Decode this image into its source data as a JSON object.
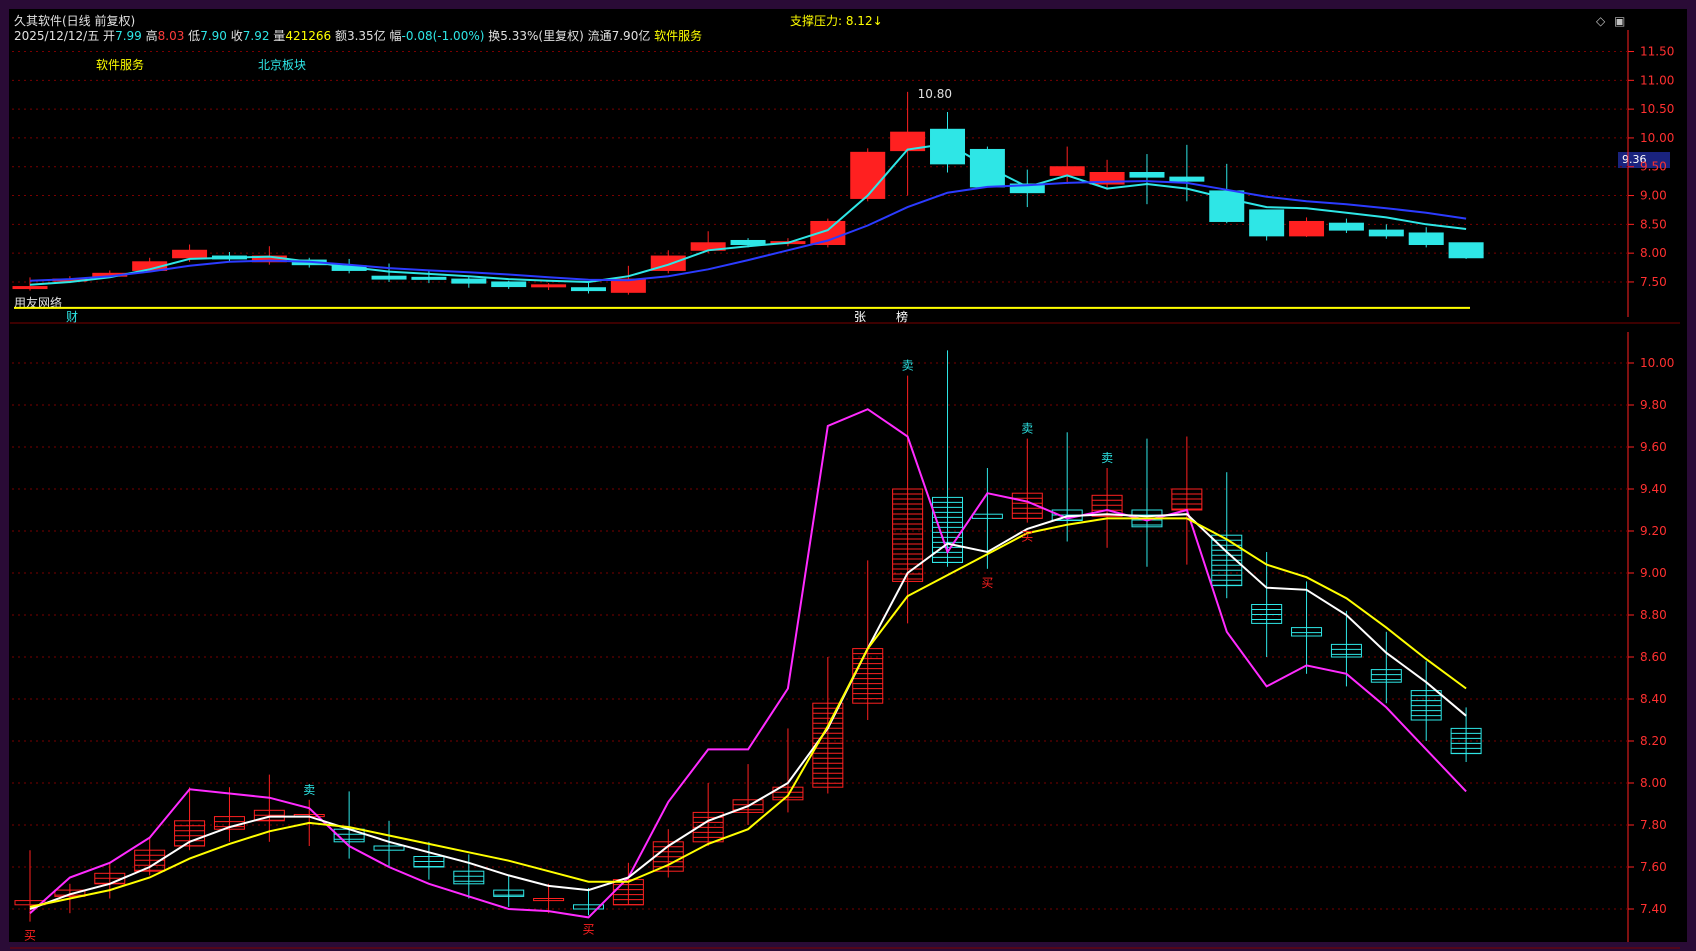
{
  "header": {
    "stock_title": "久其软件(日线 前复权)",
    "support_pressure": "支撑压力: 8.12",
    "date": "2025/12/12/五",
    "open_label": "开",
    "open": "7.99",
    "high_label": "高",
    "high": "8.03",
    "low_label": "低",
    "low": "7.90",
    "close_label": "收",
    "close": "7.92",
    "volume_label": "量",
    "volume": "421266",
    "amount_label": "额",
    "amount": "3.35亿",
    "change_label": "幅",
    "change": "-0.08(-1.00%)",
    "turnover_label": "换",
    "turnover": "5.33%(里复权)",
    "float_label": "流通",
    "float": "7.90亿",
    "sector": "软件服务"
  },
  "tags": {
    "industry": "软件服务",
    "region": "北京板块",
    "bottom_left": "用友网络",
    "cai": "财",
    "zhang": "张",
    "bang": "榜",
    "top_axis_value": "9.36",
    "high_marker": "10.80"
  },
  "icons": [
    "diamond-icon",
    "window-icon"
  ],
  "colors": {
    "up": "#ff2020",
    "down": "#2ee6e6",
    "ma5": "#ff2bff",
    "ma10": "#ffffff",
    "ma20": "#ffff00",
    "grid": "#7a0000",
    "axis": "#ff3030"
  },
  "chart_data": [
    {
      "type": "candlestick",
      "title": "",
      "ylim": [
        7.1,
        11.7
      ],
      "y_ticks": [
        7.5,
        8.0,
        8.5,
        9.0,
        9.5,
        10.0,
        10.5,
        11.0,
        11.5
      ],
      "open": [
        7.4,
        7.52,
        7.6,
        7.7,
        7.92,
        7.95,
        7.85,
        7.88,
        7.78,
        7.6,
        7.58,
        7.55,
        7.5,
        7.42,
        7.4,
        7.32,
        7.7,
        8.05,
        8.22,
        8.18,
        8.15,
        8.95,
        9.78,
        10.15,
        9.8,
        9.2,
        9.35,
        9.2,
        9.4,
        9.32,
        9.08,
        8.75,
        8.3,
        8.52,
        8.4,
        8.35,
        8.18
      ],
      "close": [
        7.42,
        7.55,
        7.65,
        7.85,
        8.05,
        7.9,
        7.95,
        7.8,
        7.7,
        7.55,
        7.55,
        7.48,
        7.42,
        7.45,
        7.35,
        7.55,
        7.95,
        8.18,
        8.15,
        8.2,
        8.55,
        9.75,
        10.1,
        9.55,
        9.15,
        9.05,
        9.5,
        9.4,
        9.32,
        9.25,
        8.55,
        8.3,
        8.55,
        8.4,
        8.3,
        8.15,
        7.92
      ],
      "high": [
        7.58,
        7.6,
        7.7,
        7.92,
        8.15,
        8.02,
        8.12,
        7.92,
        7.9,
        7.82,
        7.7,
        7.6,
        7.52,
        7.48,
        7.5,
        7.78,
        8.05,
        8.38,
        8.26,
        8.26,
        8.6,
        9.82,
        10.8,
        10.45,
        9.85,
        9.45,
        9.85,
        9.62,
        9.72,
        9.88,
        9.55,
        8.7,
        8.62,
        8.6,
        8.5,
        8.45,
        8.03
      ],
      "low": [
        7.35,
        7.48,
        7.57,
        7.68,
        7.85,
        7.85,
        7.8,
        7.75,
        7.65,
        7.5,
        7.48,
        7.4,
        7.38,
        7.36,
        7.3,
        7.28,
        7.65,
        8.0,
        8.1,
        8.12,
        8.1,
        8.9,
        9.0,
        9.4,
        9.3,
        8.8,
        9.2,
        9.1,
        8.85,
        8.9,
        8.52,
        8.22,
        8.28,
        8.35,
        8.25,
        8.1,
        7.9
      ],
      "lines": [
        {
          "name": "",
          "color": "#2ee6e6",
          "values": [
            7.45,
            7.5,
            7.58,
            7.72,
            7.9,
            7.92,
            7.94,
            7.85,
            7.76,
            7.68,
            7.64,
            7.6,
            7.55,
            7.52,
            7.5,
            7.6,
            7.8,
            8.05,
            8.12,
            8.18,
            8.4,
            9.0,
            9.8,
            9.9,
            9.5,
            9.15,
            9.35,
            9.12,
            9.2,
            9.12,
            8.95,
            8.8,
            8.78,
            8.7,
            8.62,
            8.5,
            8.42
          ]
        },
        {
          "name": "",
          "color": "#2b3bff",
          "values": [
            7.52,
            7.55,
            7.6,
            7.68,
            7.78,
            7.85,
            7.87,
            7.85,
            7.8,
            7.74,
            7.7,
            7.67,
            7.63,
            7.58,
            7.54,
            7.53,
            7.6,
            7.72,
            7.88,
            8.05,
            8.22,
            8.48,
            8.8,
            9.05,
            9.15,
            9.18,
            9.22,
            9.24,
            9.25,
            9.22,
            9.1,
            8.98,
            8.9,
            8.85,
            8.78,
            8.7,
            8.6
          ]
        }
      ],
      "support_line": 7.05
    },
    {
      "type": "candlestick",
      "title": "",
      "ylim": [
        7.3,
        10.1
      ],
      "y_ticks": [
        7.4,
        7.6,
        7.8,
        8.0,
        8.2,
        8.4,
        8.6,
        8.8,
        9.0,
        9.2,
        9.4,
        9.6,
        9.8,
        10.0
      ],
      "open": [
        7.42,
        7.46,
        7.52,
        7.58,
        7.7,
        7.78,
        7.82,
        7.84,
        7.78,
        7.7,
        7.65,
        7.58,
        7.49,
        7.44,
        7.42,
        7.42,
        7.58,
        7.72,
        7.86,
        7.92,
        7.98,
        8.38,
        8.96,
        9.36,
        9.28,
        9.26,
        9.3,
        9.27,
        9.3,
        9.3,
        9.18,
        8.85,
        8.74,
        8.66,
        8.54,
        8.44,
        8.26
      ],
      "close": [
        7.44,
        7.49,
        7.57,
        7.68,
        7.82,
        7.84,
        7.87,
        7.85,
        7.72,
        7.68,
        7.6,
        7.52,
        7.46,
        7.45,
        7.4,
        7.54,
        7.72,
        7.86,
        7.92,
        7.98,
        8.38,
        8.64,
        9.4,
        9.05,
        9.26,
        9.38,
        9.25,
        9.37,
        9.22,
        9.4,
        8.94,
        8.76,
        8.7,
        8.6,
        8.48,
        8.3,
        8.14
      ],
      "high": [
        7.68,
        7.52,
        7.62,
        7.74,
        7.98,
        7.98,
        8.04,
        7.92,
        7.96,
        7.82,
        7.72,
        7.66,
        7.56,
        7.52,
        7.5,
        7.62,
        7.78,
        8.0,
        8.09,
        8.26,
        8.6,
        9.06,
        9.94,
        10.06,
        9.5,
        9.64,
        9.67,
        9.5,
        9.64,
        9.65,
        9.48,
        9.1,
        8.96,
        8.82,
        8.72,
        8.58,
        8.36
      ],
      "low": [
        7.34,
        7.38,
        7.45,
        7.56,
        7.68,
        7.72,
        7.72,
        7.7,
        7.64,
        7.6,
        7.54,
        7.45,
        7.41,
        7.38,
        7.37,
        7.42,
        7.55,
        7.7,
        7.8,
        7.86,
        7.95,
        8.3,
        8.76,
        9.03,
        9.02,
        9.24,
        9.15,
        9.12,
        9.03,
        9.04,
        8.88,
        8.6,
        8.52,
        8.46,
        8.38,
        8.2,
        8.1
      ],
      "lines": [
        {
          "name": "",
          "color": "#ff2bff",
          "values": [
            7.38,
            7.55,
            7.62,
            7.74,
            7.97,
            7.95,
            7.93,
            7.88,
            7.7,
            7.6,
            7.52,
            7.46,
            7.4,
            7.39,
            7.36,
            7.55,
            7.91,
            8.16,
            8.16,
            8.45,
            9.7,
            9.78,
            9.65,
            9.1,
            9.38,
            9.34,
            9.26,
            9.3,
            9.25,
            9.3,
            8.72,
            8.46,
            8.56,
            8.52,
            8.36,
            8.16,
            7.96
          ]
        },
        {
          "name": "",
          "color": "#ffffff",
          "values": [
            7.4,
            7.47,
            7.52,
            7.6,
            7.72,
            7.79,
            7.84,
            7.84,
            7.78,
            7.72,
            7.67,
            7.62,
            7.56,
            7.51,
            7.49,
            7.55,
            7.7,
            7.82,
            7.89,
            8.0,
            8.26,
            8.64,
            9.0,
            9.14,
            9.1,
            9.21,
            9.27,
            9.28,
            9.27,
            9.28,
            9.1,
            8.93,
            8.92,
            8.8,
            8.62,
            8.48,
            8.32
          ]
        },
        {
          "name": "",
          "color": "#ffff00",
          "values": [
            7.41,
            7.45,
            7.49,
            7.55,
            7.64,
            7.71,
            7.77,
            7.81,
            7.79,
            7.75,
            7.71,
            7.67,
            7.63,
            7.58,
            7.53,
            7.53,
            7.61,
            7.71,
            7.78,
            7.94,
            8.27,
            8.64,
            8.89,
            8.99,
            9.09,
            9.19,
            9.23,
            9.26,
            9.26,
            9.26,
            9.16,
            9.04,
            8.98,
            8.88,
            8.74,
            8.59,
            8.45
          ]
        }
      ],
      "buy_marks": [
        0,
        14,
        24,
        25
      ],
      "sell_marks": [
        7,
        22,
        25,
        27
      ]
    }
  ]
}
